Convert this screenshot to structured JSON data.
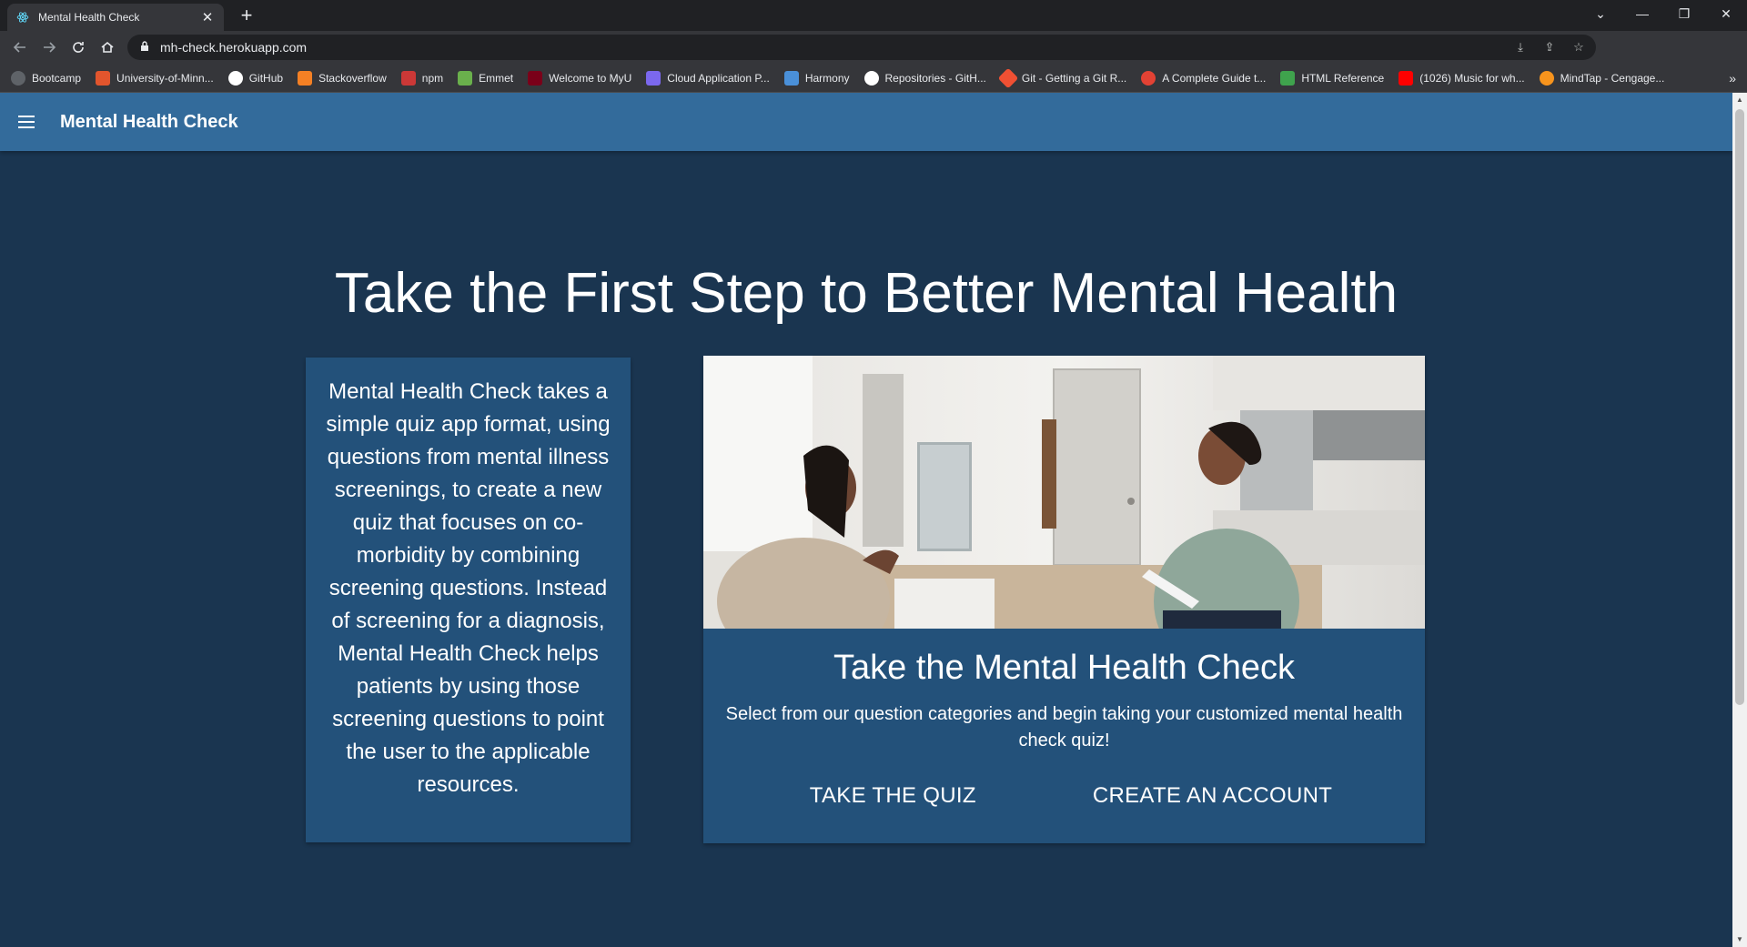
{
  "browser": {
    "tab_title": "Mental Health Check",
    "url": "mh-check.herokuapp.com",
    "bookmarks": [
      {
        "label": "Bootcamp",
        "color": "#5f6368"
      },
      {
        "label": "University-of-Minn...",
        "color": "#e2552d"
      },
      {
        "label": "GitHub",
        "color": "#24292e"
      },
      {
        "label": "Stackoverflow",
        "color": "#f48024"
      },
      {
        "label": "npm",
        "color": "#cb3837"
      },
      {
        "label": "Emmet",
        "color": "#6ab04c"
      },
      {
        "label": "Welcome to MyU",
        "color": "#7a0019"
      },
      {
        "label": "Cloud Application P...",
        "color": "#7b68ee"
      },
      {
        "label": "Harmony",
        "color": "#4a90d9"
      },
      {
        "label": "Repositories - GitH...",
        "color": "#24292e"
      },
      {
        "label": "Git - Getting a Git R...",
        "color": "#f05033"
      },
      {
        "label": "A Complete Guide t...",
        "color": "#e34234"
      },
      {
        "label": "HTML Reference",
        "color": "#3fa34d"
      },
      {
        "label": "(1026) Music for wh...",
        "color": "#ff0000"
      },
      {
        "label": "MindTap - Cengage...",
        "color": "#f7941d"
      }
    ]
  },
  "app": {
    "brand": "Mental Health Check",
    "hero_title": "Take the First Step to Better Mental Health",
    "info_text": "Mental Health Check takes a simple quiz app format, using questions from mental illness screenings, to create a new quiz that focuses on co-morbidity by combining screening questions. Instead of screening for a diagnosis, Mental Health Check helps patients by using those screening questions to point the user to the applicable resources.",
    "quiz_card": {
      "title": "Take the Mental Health Check",
      "description": "Select from our question categories and begin taking your customized mental health check quiz!",
      "primary_action": "TAKE THE QUIZ",
      "secondary_action": "CREATE AN ACCOUNT"
    }
  },
  "colors": {
    "page_bg": "#1a3550",
    "appbar_bg": "#336b9b",
    "card_bg": "#23517a"
  }
}
